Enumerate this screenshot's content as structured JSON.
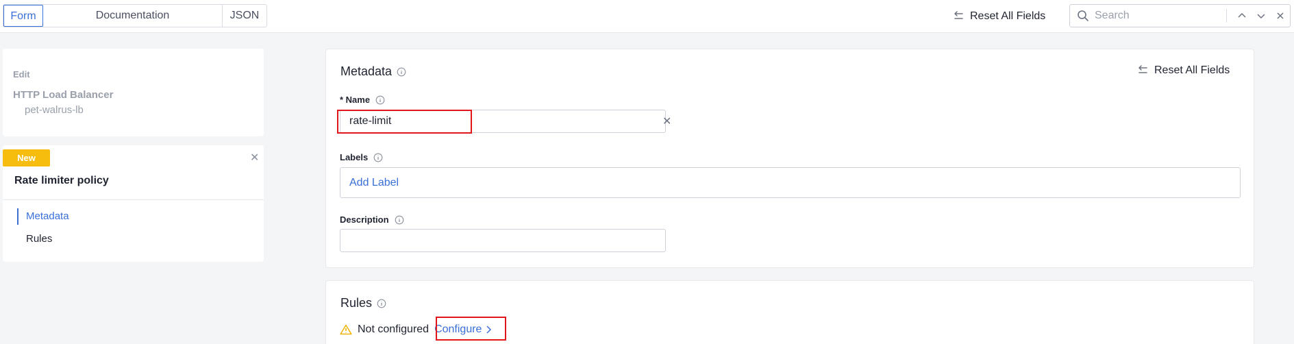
{
  "toolbar": {
    "tabs": [
      {
        "label": "Form",
        "active": true
      },
      {
        "label": "Documentation",
        "active": false
      },
      {
        "label": "JSON",
        "active": false
      }
    ],
    "reset_label": "Reset All Fields",
    "search_placeholder": "Search"
  },
  "sidebar": {
    "edit_label": "Edit",
    "object_type": "HTTP Load Balancer",
    "object_name": "pet-walrus-lb",
    "badge": "New",
    "policy_title": "Rate limiter policy",
    "nav": [
      {
        "label": "Metadata",
        "active": true
      },
      {
        "label": "Rules",
        "active": false
      }
    ]
  },
  "metadata": {
    "title": "Metadata",
    "reset_label": "Reset All Fields",
    "name_label": "* Name",
    "name_value": "rate-limit",
    "labels_label": "Labels",
    "add_label": "Add Label",
    "description_label": "Description",
    "description_value": ""
  },
  "rules": {
    "title": "Rules",
    "status": "Not configured",
    "configure_label": "Configure"
  },
  "colors": {
    "accent": "#3a6fd8",
    "badge": "#f7bd0e",
    "highlight": "#e0161b",
    "warning": "#f0b400"
  }
}
